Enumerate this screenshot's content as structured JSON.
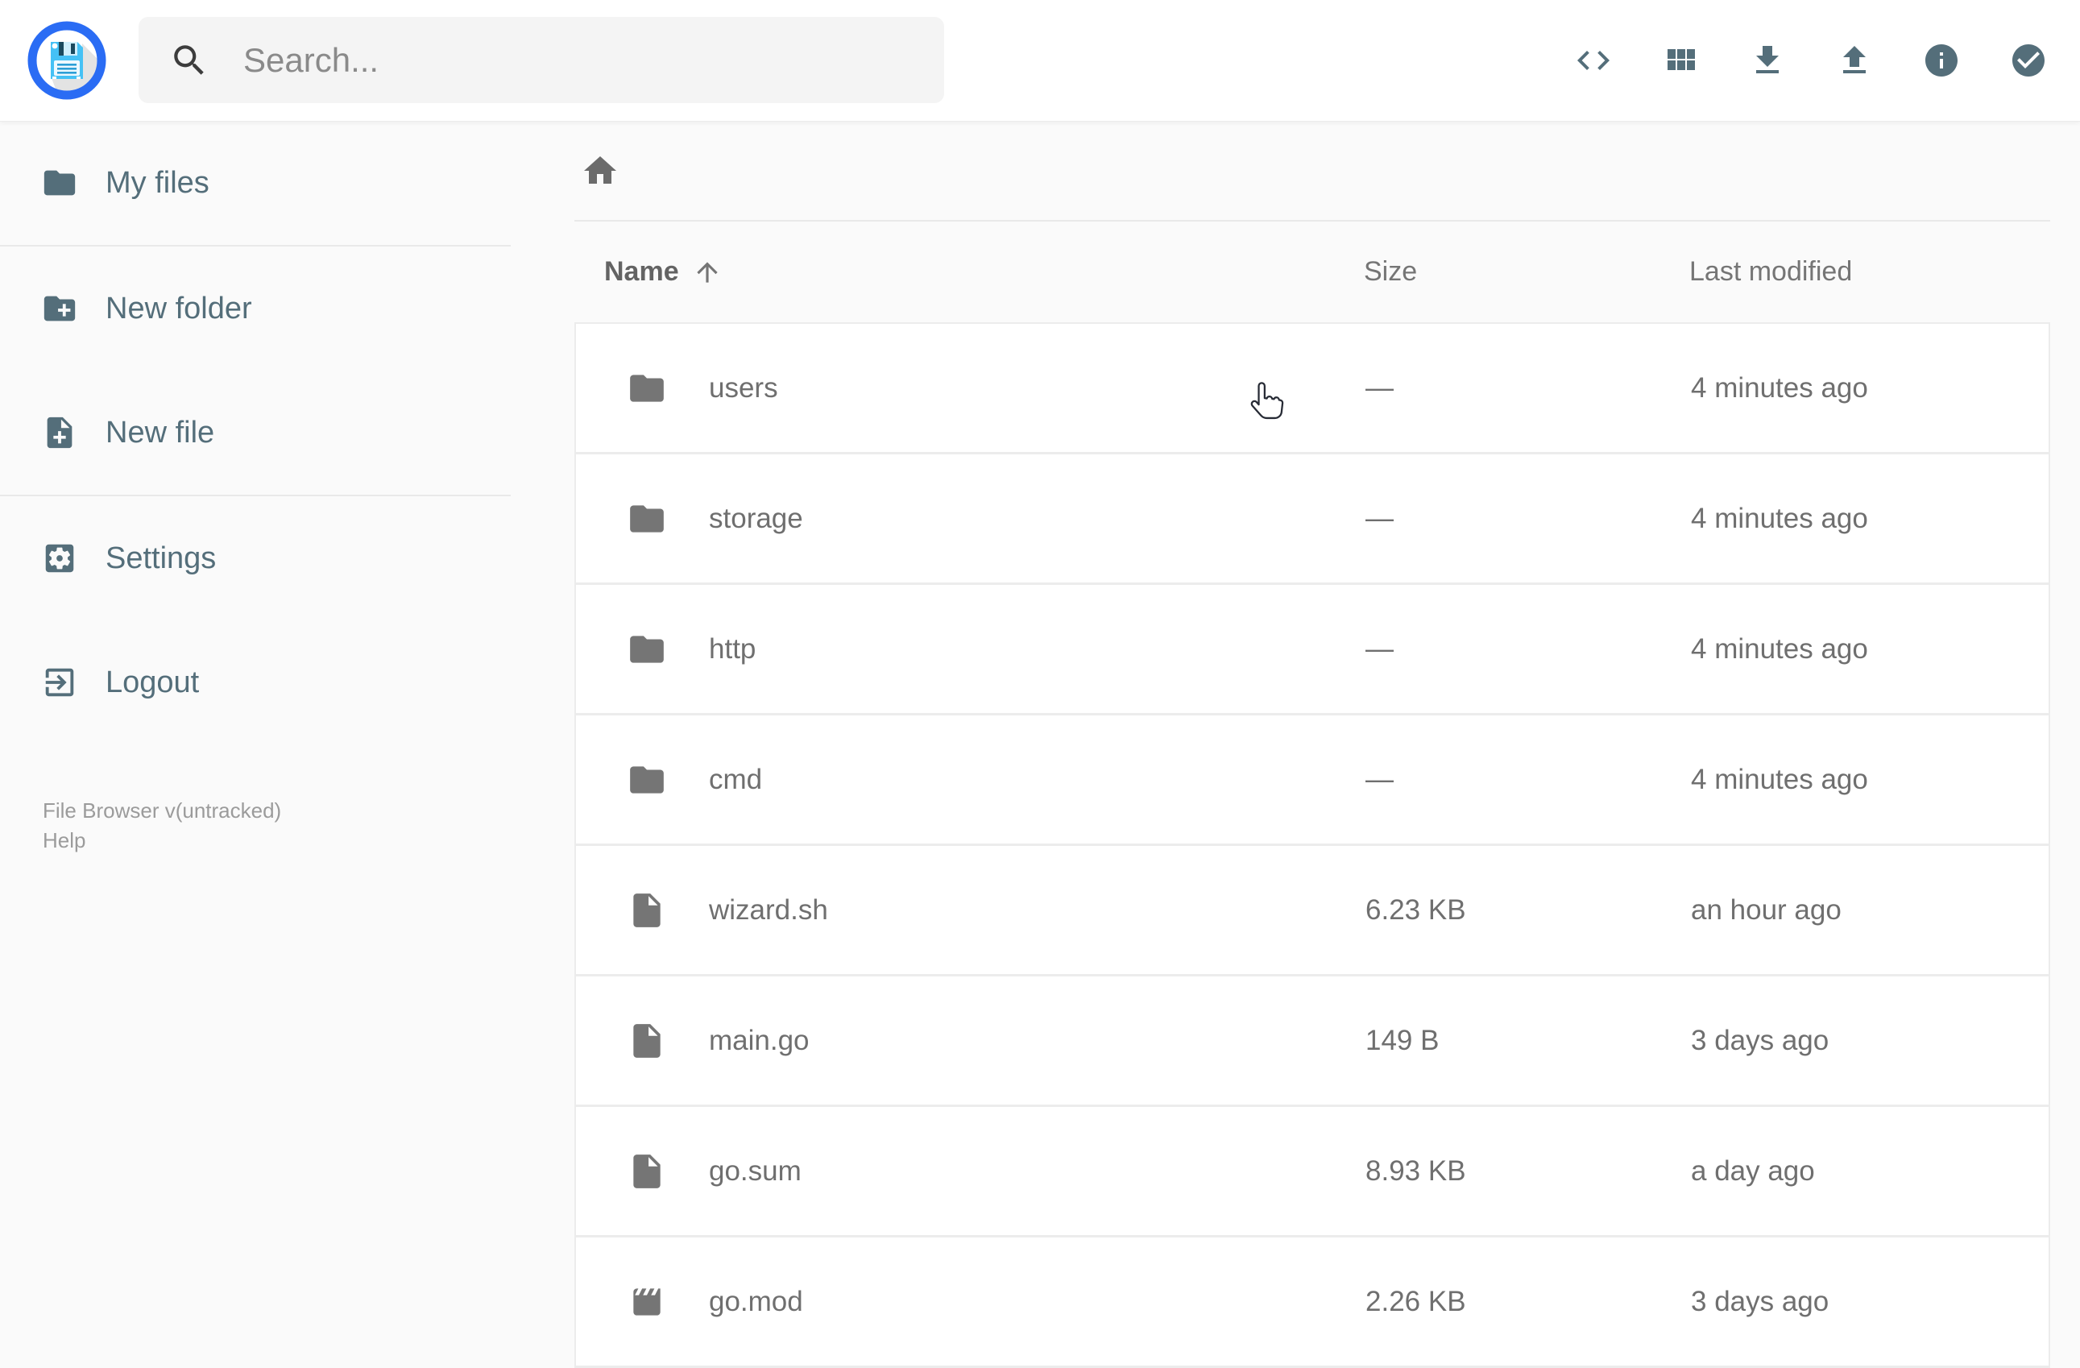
{
  "header": {
    "search_placeholder": "Search...",
    "toolbar": [
      {
        "name": "raw-view",
        "icon": "code-icon"
      },
      {
        "name": "switch-view",
        "icon": "grid-view-icon"
      },
      {
        "name": "download",
        "icon": "download-icon"
      },
      {
        "name": "upload",
        "icon": "upload-icon"
      },
      {
        "name": "info",
        "icon": "info-icon"
      },
      {
        "name": "select-multiple",
        "icon": "check-circle-icon"
      }
    ]
  },
  "sidebar": {
    "items": [
      {
        "label": "My files",
        "icon": "folder"
      },
      {
        "label": "New folder",
        "icon": "folder-plus"
      },
      {
        "label": "New file",
        "icon": "file-plus"
      },
      {
        "label": "Settings",
        "icon": "gear"
      },
      {
        "label": "Logout",
        "icon": "logout"
      }
    ],
    "footer": {
      "version": "File Browser v(untracked)",
      "help": "Help"
    }
  },
  "main": {
    "breadcrumb_root_icon": "home-icon",
    "sort": {
      "column": "name",
      "direction": "ascending"
    },
    "columns": {
      "name": "Name",
      "size": "Size",
      "modified": "Last modified"
    },
    "rows": [
      {
        "name": "users",
        "type": "folder",
        "size": "—",
        "modified": "4 minutes ago"
      },
      {
        "name": "storage",
        "type": "folder",
        "size": "—",
        "modified": "4 minutes ago"
      },
      {
        "name": "http",
        "type": "folder",
        "size": "—",
        "modified": "4 minutes ago"
      },
      {
        "name": "cmd",
        "type": "folder",
        "size": "—",
        "modified": "4 minutes ago"
      },
      {
        "name": "wizard.sh",
        "type": "file",
        "size": "6.23 KB",
        "modified": "an hour ago"
      },
      {
        "name": "main.go",
        "type": "file",
        "size": "149 B",
        "modified": "3 days ago"
      },
      {
        "name": "go.sum",
        "type": "file",
        "size": "8.93 KB",
        "modified": "a day ago"
      },
      {
        "name": "go.mod",
        "type": "movie",
        "size": "2.26 KB",
        "modified": "3 days ago"
      }
    ]
  },
  "colors": {
    "accent_blue": "#2a6cf4",
    "floppy_blue": "#45c1f5",
    "slate_icon": "#546e7a",
    "row_text_gray": "#6f6f6f",
    "page_background": "#fafafa"
  }
}
